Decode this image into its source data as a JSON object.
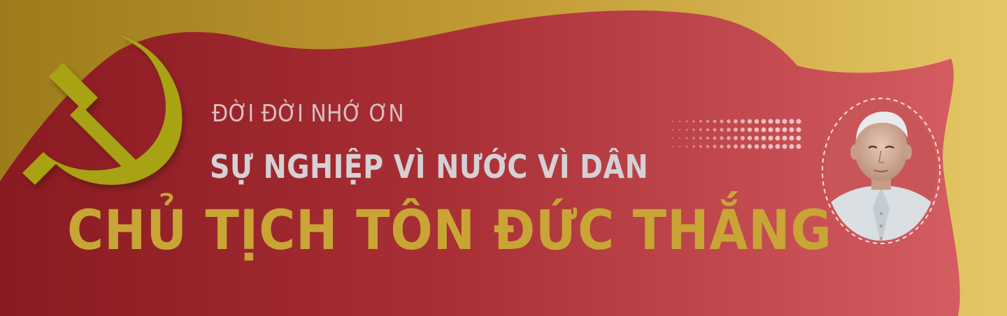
{
  "banner": {
    "subtitle": "ĐỜI ĐỜI NHỚ ƠN",
    "headline": "SỰ NGHIỆP VÌ NƯỚC VÌ DÂN",
    "title": "CHỦ TỊCH TÔN ĐỨC THẮNG"
  },
  "colors": {
    "gold_light": "#e2c25e",
    "gold_dark": "#a0801d",
    "red_dark": "#8c1c22",
    "red_light": "#d05a5e",
    "emblem": "#a7a312",
    "title_gold": "#c8a535",
    "headline_grey": "#d4d0d4",
    "subtitle_pink": "#d9bfc0"
  },
  "icons": {
    "emblem": "hammer-and-sickle-icon",
    "portrait": "portrait-ton-duc-thang"
  }
}
